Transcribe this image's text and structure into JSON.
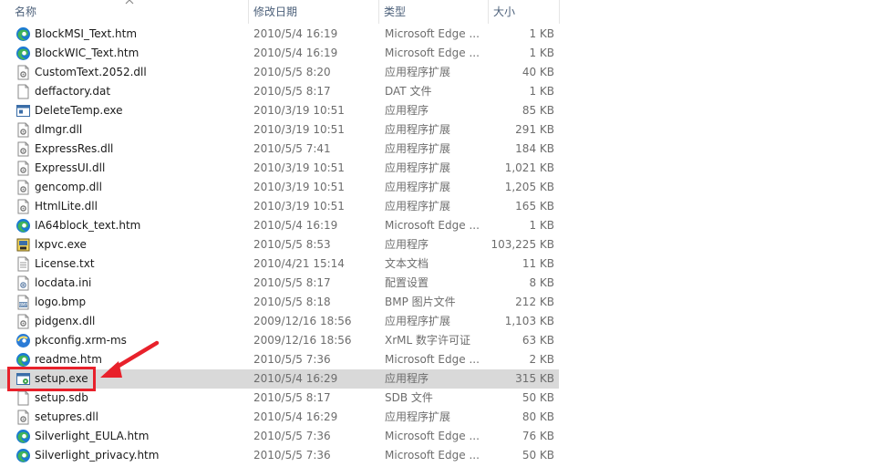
{
  "columns": {
    "name": "名称",
    "date": "修改日期",
    "type": "类型",
    "size": "大小"
  },
  "colors": {
    "selected_row": "#d9d9d9",
    "callout": "#e8212b",
    "edge_blue": "#1b7ad3",
    "edge_green": "#3fb35a"
  },
  "files": [
    {
      "name": "BlockMSI_Text.htm",
      "date": "2010/5/4 16:19",
      "type": "Microsoft Edge ...",
      "size": "1 KB",
      "icon": "edge-html-icon"
    },
    {
      "name": "BlockWIC_Text.htm",
      "date": "2010/5/4 16:19",
      "type": "Microsoft Edge ...",
      "size": "1 KB",
      "icon": "edge-html-icon"
    },
    {
      "name": "CustomText.2052.dll",
      "date": "2010/5/5 8:20",
      "type": "应用程序扩展",
      "size": "40 KB",
      "icon": "dll-file-icon"
    },
    {
      "name": "deffactory.dat",
      "date": "2010/5/5 8:17",
      "type": "DAT 文件",
      "size": "1 KB",
      "icon": "blank-file-icon"
    },
    {
      "name": "DeleteTemp.exe",
      "date": "2010/3/19 10:51",
      "type": "应用程序",
      "size": "85 KB",
      "icon": "exe-app-icon"
    },
    {
      "name": "dlmgr.dll",
      "date": "2010/3/19 10:51",
      "type": "应用程序扩展",
      "size": "291 KB",
      "icon": "dll-file-icon"
    },
    {
      "name": "ExpressRes.dll",
      "date": "2010/5/5 7:41",
      "type": "应用程序扩展",
      "size": "184 KB",
      "icon": "dll-file-icon"
    },
    {
      "name": "ExpressUI.dll",
      "date": "2010/3/19 10:51",
      "type": "应用程序扩展",
      "size": "1,021 KB",
      "icon": "dll-file-icon"
    },
    {
      "name": "gencomp.dll",
      "date": "2010/3/19 10:51",
      "type": "应用程序扩展",
      "size": "1,205 KB",
      "icon": "dll-file-icon"
    },
    {
      "name": "HtmlLite.dll",
      "date": "2010/3/19 10:51",
      "type": "应用程序扩展",
      "size": "165 KB",
      "icon": "dll-file-icon"
    },
    {
      "name": "IA64block_text.htm",
      "date": "2010/5/4 16:19",
      "type": "Microsoft Edge ...",
      "size": "1 KB",
      "icon": "edge-html-icon"
    },
    {
      "name": "lxpvc.exe",
      "date": "2010/5/5 8:53",
      "type": "应用程序",
      "size": "103,225 KB",
      "icon": "installer-exe-icon"
    },
    {
      "name": "License.txt",
      "date": "2010/4/21 15:14",
      "type": "文本文档",
      "size": "11 KB",
      "icon": "text-file-icon"
    },
    {
      "name": "locdata.ini",
      "date": "2010/5/5 8:17",
      "type": "配置设置",
      "size": "8 KB",
      "icon": "ini-file-icon"
    },
    {
      "name": "logo.bmp",
      "date": "2010/5/5 8:18",
      "type": "BMP 图片文件",
      "size": "212 KB",
      "icon": "bmp-file-icon"
    },
    {
      "name": "pidgenx.dll",
      "date": "2009/12/16 18:56",
      "type": "应用程序扩展",
      "size": "1,103 KB",
      "icon": "dll-file-icon"
    },
    {
      "name": "pkconfig.xrm-ms",
      "date": "2009/12/16 18:56",
      "type": "XrML 数字许可证",
      "size": "63 KB",
      "icon": "xrml-file-icon"
    },
    {
      "name": "readme.htm",
      "date": "2010/5/5 7:36",
      "type": "Microsoft Edge ...",
      "size": "2 KB",
      "icon": "edge-html-icon"
    },
    {
      "name": "setup.exe",
      "date": "2010/5/4 16:29",
      "type": "应用程序",
      "size": "315 KB",
      "icon": "setup-exe-icon",
      "selected": true
    },
    {
      "name": "setup.sdb",
      "date": "2010/5/5 8:17",
      "type": "SDB 文件",
      "size": "50 KB",
      "icon": "blank-file-icon"
    },
    {
      "name": "setupres.dll",
      "date": "2010/5/4 16:29",
      "type": "应用程序扩展",
      "size": "80 KB",
      "icon": "dll-file-icon"
    },
    {
      "name": "Silverlight_EULA.htm",
      "date": "2010/5/5 7:36",
      "type": "Microsoft Edge ...",
      "size": "76 KB",
      "icon": "edge-html-icon"
    },
    {
      "name": "Silverlight_privacy.htm",
      "date": "2010/5/5 7:36",
      "type": "Microsoft Edge ...",
      "size": "50 KB",
      "icon": "edge-html-icon"
    }
  ]
}
